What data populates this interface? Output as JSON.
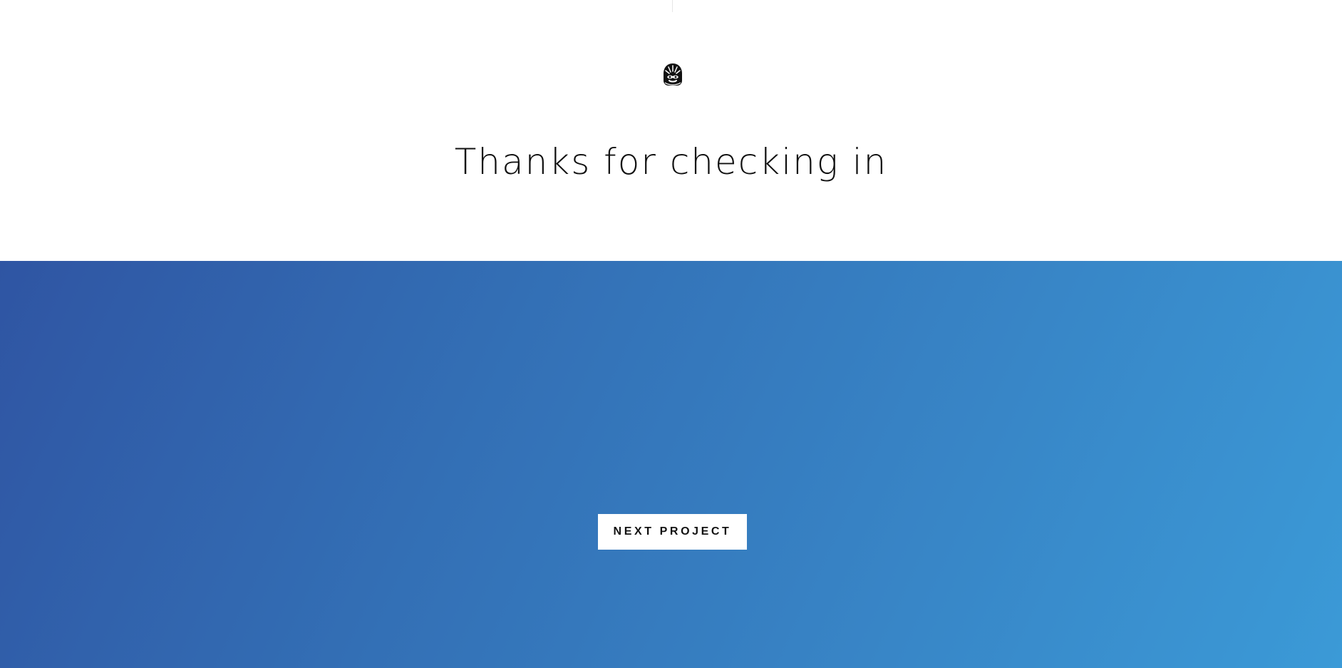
{
  "header": {
    "logo_icon": "helmet-logo-icon"
  },
  "main": {
    "headline": "Thanks for checking in"
  },
  "footer": {
    "next_button_label": "NEXT PROJECT",
    "gradient_colors": [
      "#2f55a3",
      "#336fb5",
      "#3886c7",
      "#3b9ad7"
    ]
  }
}
